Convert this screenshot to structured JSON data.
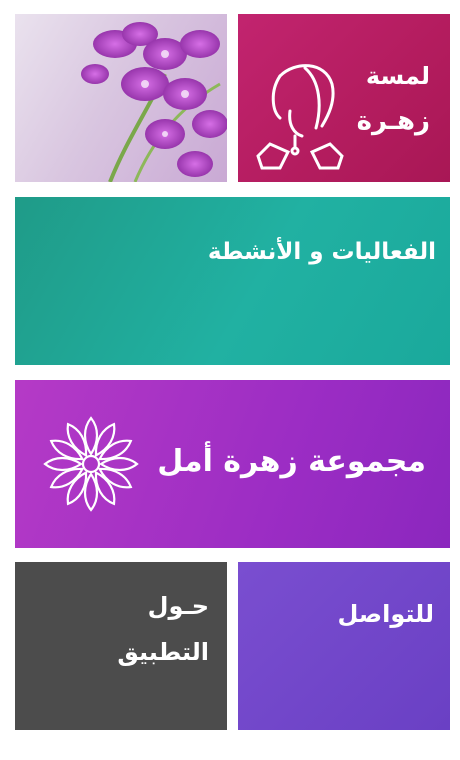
{
  "tiles": {
    "lamsa": {
      "line1": "لمسة",
      "line2": "زهـرة"
    },
    "events": {
      "label": "الفعاليات و الأنشطة"
    },
    "group": {
      "label": "مجموعة زهرة أمل"
    },
    "about": {
      "line1": "حـول",
      "line2": "التطبيق"
    },
    "contact": {
      "label": "للتواصل"
    }
  },
  "colors": {
    "lamsa": "#b61d63",
    "events": "#20a896",
    "group": "#a030c4",
    "about": "#4c4c4c",
    "contact": "#6f45c8"
  },
  "icons": [
    "orchid-photo",
    "woman-silhouette-icon",
    "flower-logo-icon"
  ]
}
